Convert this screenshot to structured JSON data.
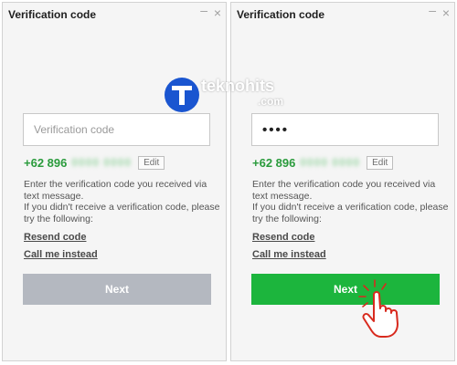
{
  "panels": [
    {
      "title": "Verification code",
      "input": {
        "value": "",
        "placeholder": "Verification code"
      },
      "phone": "+62 896",
      "phone_hidden": "0000 0000",
      "edit_label": "Edit",
      "desc": [
        "Enter the verification code you received via text message.",
        "If you didn't receive a verification code, please try the following:"
      ],
      "resend_label": "Resend code",
      "call_label": "Call me instead",
      "next_label": "Next",
      "next_state": "disabled"
    },
    {
      "title": "Verification code",
      "input": {
        "value": "••••",
        "placeholder": "Verification code"
      },
      "phone": "+62 896",
      "phone_hidden": "0000 0000",
      "edit_label": "Edit",
      "desc": [
        "Enter the verification code you received via text message.",
        "If you didn't receive a verification code, please try the following:"
      ],
      "resend_label": "Resend code",
      "call_label": "Call me instead",
      "next_label": "Next",
      "next_state": "active"
    }
  ],
  "window_controls": {
    "minimize": "–",
    "close": "×"
  },
  "watermark": {
    "text": "teknohits",
    "sub": ".com"
  },
  "icons": {
    "pointer": "hand-pointer-icon",
    "click_burst": "click-burst-icon",
    "watermark_logo": "teknohits-t-logo-icon"
  },
  "colors": {
    "phone_green": "#2a9b3c",
    "next_active": "#1cb53d",
    "next_disabled": "#b4b8c0",
    "panel_bg": "#f5f5f5",
    "hand_red": "#d82a1e",
    "watermark_blue": "#1a55d0"
  }
}
